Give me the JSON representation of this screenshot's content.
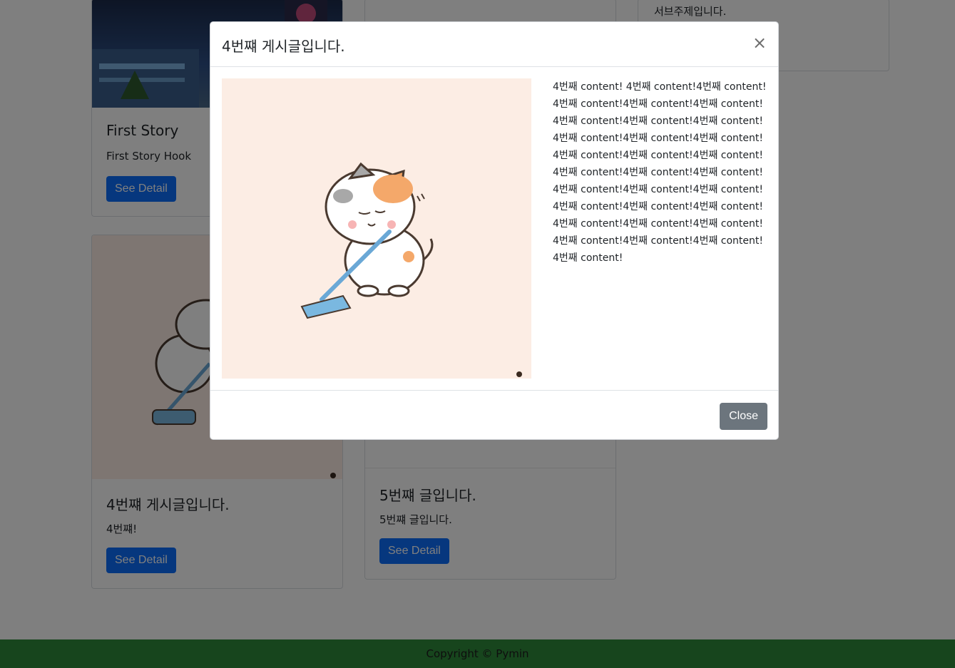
{
  "cards": {
    "first_story": {
      "title": "First Story",
      "hook": "First Story Hook",
      "button": "See Detail"
    },
    "fourth": {
      "title": "4번쨰 게시글입니다.",
      "hook": "4번쨰!",
      "button": "See Detail"
    },
    "fifth": {
      "title": "5번쨰 글입니다.",
      "hook": "5번쨰 글입니다.",
      "button": "See Detail"
    },
    "side": {
      "subtitle": "서브주제입니다."
    }
  },
  "modal": {
    "title": "4번쨰 게시글입니다.",
    "close_symbol": "×",
    "content": "4번째 content! 4번째 content!4번째 content!4번째 content!4번째 content!4번째 content!4번째 content!4번째 content!4번째 content!4번째 content!4번째 content!4번째 content!4번째 content!4번째 content!4번째 content!4번째 content!4번째 content!4번째 content!4번째 content!4번째 content!4번째 content!4번째 content!4번째 content!4번째 content!4번째 content!4번째 content!4번째 content!4번째 content!4번째 content!4번째 content!4번째 content!",
    "close_button": "Close"
  },
  "footer": {
    "copyright": "Copyright © Pymin"
  },
  "colors": {
    "primary": "#0d6efd",
    "secondary": "#6c757d",
    "footer": "#2f8a3b",
    "image_bg": "#fcede4"
  }
}
